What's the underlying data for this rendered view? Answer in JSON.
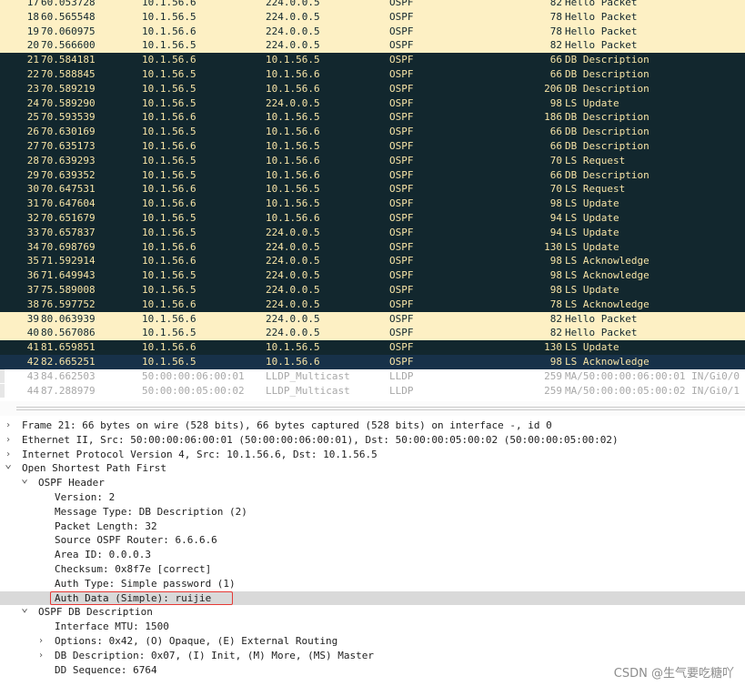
{
  "packets": [
    {
      "no": "17",
      "time": "60.053728",
      "src": "10.1.56.6",
      "dst": "224.0.0.5",
      "proto": "OSPF",
      "len": "82",
      "info": "Hello Packet",
      "style": "hello"
    },
    {
      "no": "18",
      "time": "60.565548",
      "src": "10.1.56.5",
      "dst": "224.0.0.5",
      "proto": "OSPF",
      "len": "78",
      "info": "Hello Packet",
      "style": "hello"
    },
    {
      "no": "19",
      "time": "70.060975",
      "src": "10.1.56.6",
      "dst": "224.0.0.5",
      "proto": "OSPF",
      "len": "78",
      "info": "Hello Packet",
      "style": "hello"
    },
    {
      "no": "20",
      "time": "70.566600",
      "src": "10.1.56.5",
      "dst": "224.0.0.5",
      "proto": "OSPF",
      "len": "82",
      "info": "Hello Packet",
      "style": "hello"
    },
    {
      "no": "21",
      "time": "70.584181",
      "src": "10.1.56.6",
      "dst": "10.1.56.5",
      "proto": "OSPF",
      "len": "66",
      "info": "DB Description",
      "style": "dark"
    },
    {
      "no": "22",
      "time": "70.588845",
      "src": "10.1.56.5",
      "dst": "10.1.56.6",
      "proto": "OSPF",
      "len": "66",
      "info": "DB Description",
      "style": "dark"
    },
    {
      "no": "23",
      "time": "70.589219",
      "src": "10.1.56.5",
      "dst": "10.1.56.6",
      "proto": "OSPF",
      "len": "206",
      "info": "DB Description",
      "style": "dark"
    },
    {
      "no": "24",
      "time": "70.589290",
      "src": "10.1.56.5",
      "dst": "224.0.0.5",
      "proto": "OSPF",
      "len": "98",
      "info": "LS Update",
      "style": "dark"
    },
    {
      "no": "25",
      "time": "70.593539",
      "src": "10.1.56.6",
      "dst": "10.1.56.5",
      "proto": "OSPF",
      "len": "186",
      "info": "DB Description",
      "style": "dark"
    },
    {
      "no": "26",
      "time": "70.630169",
      "src": "10.1.56.5",
      "dst": "10.1.56.6",
      "proto": "OSPF",
      "len": "66",
      "info": "DB Description",
      "style": "dark"
    },
    {
      "no": "27",
      "time": "70.635173",
      "src": "10.1.56.6",
      "dst": "10.1.56.5",
      "proto": "OSPF",
      "len": "66",
      "info": "DB Description",
      "style": "dark"
    },
    {
      "no": "28",
      "time": "70.639293",
      "src": "10.1.56.5",
      "dst": "10.1.56.6",
      "proto": "OSPF",
      "len": "70",
      "info": "LS Request",
      "style": "dark"
    },
    {
      "no": "29",
      "time": "70.639352",
      "src": "10.1.56.5",
      "dst": "10.1.56.6",
      "proto": "OSPF",
      "len": "66",
      "info": "DB Description",
      "style": "dark"
    },
    {
      "no": "30",
      "time": "70.647531",
      "src": "10.1.56.6",
      "dst": "10.1.56.5",
      "proto": "OSPF",
      "len": "70",
      "info": "LS Request",
      "style": "dark"
    },
    {
      "no": "31",
      "time": "70.647604",
      "src": "10.1.56.6",
      "dst": "10.1.56.5",
      "proto": "OSPF",
      "len": "98",
      "info": "LS Update",
      "style": "dark"
    },
    {
      "no": "32",
      "time": "70.651679",
      "src": "10.1.56.5",
      "dst": "10.1.56.6",
      "proto": "OSPF",
      "len": "94",
      "info": "LS Update",
      "style": "dark"
    },
    {
      "no": "33",
      "time": "70.657837",
      "src": "10.1.56.5",
      "dst": "224.0.0.5",
      "proto": "OSPF",
      "len": "94",
      "info": "LS Update",
      "style": "dark"
    },
    {
      "no": "34",
      "time": "70.698769",
      "src": "10.1.56.6",
      "dst": "224.0.0.5",
      "proto": "OSPF",
      "len": "130",
      "info": "LS Update",
      "style": "dark"
    },
    {
      "no": "35",
      "time": "71.592914",
      "src": "10.1.56.6",
      "dst": "224.0.0.5",
      "proto": "OSPF",
      "len": "98",
      "info": "LS Acknowledge",
      "style": "dark"
    },
    {
      "no": "36",
      "time": "71.649943",
      "src": "10.1.56.5",
      "dst": "224.0.0.5",
      "proto": "OSPF",
      "len": "98",
      "info": "LS Acknowledge",
      "style": "dark"
    },
    {
      "no": "37",
      "time": "75.589008",
      "src": "10.1.56.5",
      "dst": "224.0.0.5",
      "proto": "OSPF",
      "len": "98",
      "info": "LS Update",
      "style": "dark"
    },
    {
      "no": "38",
      "time": "76.597752",
      "src": "10.1.56.6",
      "dst": "224.0.0.5",
      "proto": "OSPF",
      "len": "78",
      "info": "LS Acknowledge",
      "style": "dark"
    },
    {
      "no": "39",
      "time": "80.063939",
      "src": "10.1.56.6",
      "dst": "224.0.0.5",
      "proto": "OSPF",
      "len": "82",
      "info": "Hello Packet",
      "style": "hello"
    },
    {
      "no": "40",
      "time": "80.567086",
      "src": "10.1.56.5",
      "dst": "224.0.0.5",
      "proto": "OSPF",
      "len": "82",
      "info": "Hello Packet",
      "style": "hello"
    },
    {
      "no": "41",
      "time": "81.659851",
      "src": "10.1.56.6",
      "dst": "10.1.56.5",
      "proto": "OSPF",
      "len": "130",
      "info": "LS Update",
      "style": "dark"
    },
    {
      "no": "42",
      "time": "82.665251",
      "src": "10.1.56.5",
      "dst": "10.1.56.6",
      "proto": "OSPF",
      "len": "98",
      "info": "LS Acknowledge",
      "style": "sel"
    },
    {
      "no": "43",
      "time": "84.662503",
      "src": "50:00:00:06:00:01",
      "dst": "LLDP_Multicast",
      "proto": "LLDP",
      "len": "259",
      "info": "MA/50:00:00:06:00:01 IN/Gi0/0 1",
      "style": "faded"
    },
    {
      "no": "44",
      "time": "87.288979",
      "src": "50:00:00:05:00:02",
      "dst": "LLDP_Multicast",
      "proto": "LLDP",
      "len": "259",
      "info": "MA/50:00:00:05:00:02 IN/Gi0/1 1",
      "style": "faded"
    }
  ],
  "details": [
    {
      "indent": 0,
      "arrow": "collapsed",
      "text": "Frame 21: 66 bytes on wire (528 bits), 66 bytes captured (528 bits) on interface -, id 0"
    },
    {
      "indent": 0,
      "arrow": "collapsed",
      "text": "Ethernet II, Src: 50:00:00:06:00:01 (50:00:00:06:00:01), Dst: 50:00:00:05:00:02 (50:00:00:05:00:02)"
    },
    {
      "indent": 0,
      "arrow": "collapsed",
      "text": "Internet Protocol Version 4, Src: 10.1.56.6, Dst: 10.1.56.5"
    },
    {
      "indent": 0,
      "arrow": "expanded",
      "text": "Open Shortest Path First"
    },
    {
      "indent": 1,
      "arrow": "expanded",
      "text": "OSPF Header"
    },
    {
      "indent": 2,
      "arrow": "none",
      "text": "Version: 2"
    },
    {
      "indent": 2,
      "arrow": "none",
      "text": "Message Type: DB Description (2)"
    },
    {
      "indent": 2,
      "arrow": "none",
      "text": "Packet Length: 32"
    },
    {
      "indent": 2,
      "arrow": "none",
      "text": "Source OSPF Router: 6.6.6.6"
    },
    {
      "indent": 2,
      "arrow": "none",
      "text": "Area ID: 0.0.0.3"
    },
    {
      "indent": 2,
      "arrow": "none",
      "text": "Checksum: 0x8f7e [correct]"
    },
    {
      "indent": 2,
      "arrow": "none",
      "text": "Auth Type: Simple password (1)"
    },
    {
      "indent": 2,
      "arrow": "none",
      "text": "Auth Data (Simple): ruijie",
      "highlight": true
    },
    {
      "indent": 1,
      "arrow": "expanded",
      "text": "OSPF DB Description"
    },
    {
      "indent": 2,
      "arrow": "none",
      "text": "Interface MTU: 1500"
    },
    {
      "indent": 2,
      "arrow": "collapsed",
      "text": "Options: 0x42, (O) Opaque, (E) External Routing"
    },
    {
      "indent": 2,
      "arrow": "collapsed",
      "text": "DB Description: 0x07, (I) Init, (M) More, (MS) Master"
    },
    {
      "indent": 2,
      "arrow": "none",
      "text": "DD Sequence: 6764"
    }
  ],
  "icons": {
    "collapsed": "chevron-right-icon",
    "expanded": "chevron-down-icon"
  },
  "colors": {
    "hello_bg": "#fdf0c4",
    "dark_bg": "#12272e",
    "selected_bg": "#173149",
    "dark_fg": "#f7e4a6",
    "highlight_box": "#e53935"
  },
  "watermark": "CSDN @生气要吃糖吖"
}
